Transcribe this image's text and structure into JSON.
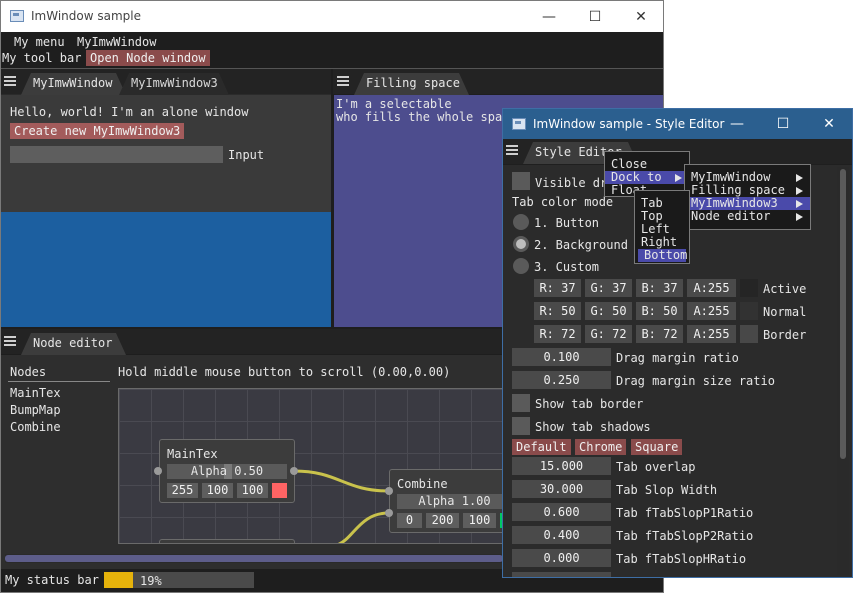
{
  "main_window": {
    "title": "ImWindow sample",
    "controls": {
      "minimize": "—",
      "maximize": "☐",
      "close": "✕"
    },
    "menu": [
      "My menu",
      "MyImwWindow"
    ],
    "toolbar": {
      "label": "My tool bar",
      "open_node_button": "Open Node window"
    },
    "left_panel": {
      "tabs": [
        "MyImwWindow",
        "MyImwWindow3"
      ],
      "hello_text": "Hello, world! I'm an alone window",
      "create_button": "Create new MyImwWindow3",
      "input_label": "Input",
      "input_value": ""
    },
    "right_panel": {
      "tab": "Filling space",
      "selectable_text": [
        "I'm a selectable",
        "who fills the whole space"
      ]
    },
    "node_editor": {
      "tab": "Node editor",
      "list_header": "Nodes",
      "nodes_list": [
        "MainTex",
        "BumpMap",
        "Combine"
      ],
      "hint": "Hold middle mouse button to scroll (0.00,0.00)",
      "node_maintex": {
        "title": "MainTex",
        "alpha_label": "Alpha 0.50",
        "rgb": [
          "255",
          "100",
          "100"
        ],
        "swatch": "#ff6464"
      },
      "node_combine": {
        "title": "Combine",
        "alpha_label": "Alpha 1.00",
        "rgb": [
          "0",
          "200",
          "100"
        ],
        "swatch": "#00c864"
      }
    },
    "status_bar": {
      "label": "My status bar",
      "progress_text": "19%",
      "progress": 0.19
    }
  },
  "style_editor": {
    "title": "ImWindow sample - Style Editor",
    "tab": "Style Editor",
    "visible_drag_label": "Visible dr",
    "tab_color_mode_label": "Tab color mode",
    "radio_options": [
      "1. Button",
      "2. Background",
      "3. Custom"
    ],
    "radio_selected": 1,
    "color_rows": [
      {
        "r": "R: 37",
        "g": "G: 37",
        "b": "B: 37",
        "a": "A:255",
        "label": "Active",
        "swatch": "#252525"
      },
      {
        "r": "R: 50",
        "g": "G: 50",
        "b": "B: 50",
        "a": "A:255",
        "label": "Normal",
        "swatch": "#323232"
      },
      {
        "r": "R: 72",
        "g": "G: 72",
        "b": "B: 72",
        "a": "A:255",
        "label": "Border",
        "swatch": "#484848"
      }
    ],
    "drag_margin": {
      "value": "0.100",
      "label": "Drag margin ratio"
    },
    "drag_margin_size": {
      "value": "0.250",
      "label": "Drag margin size ratio"
    },
    "show_tab_border": "Show tab border",
    "show_tab_shadows": "Show tab shadows",
    "presets": [
      "Default",
      "Chrome",
      "Square"
    ],
    "params": [
      {
        "value": "15.000",
        "label": "Tab overlap"
      },
      {
        "value": "30.000",
        "label": "Tab Slop Width"
      },
      {
        "value": "0.600",
        "label": "Tab fTabSlopP1Ratio"
      },
      {
        "value": "0.400",
        "label": "Tab fTabSlopP2Ratio"
      },
      {
        "value": "0.000",
        "label": "Tab fTabSlopHRatio"
      }
    ]
  },
  "context_menu": {
    "items": [
      "Close",
      "Dock to",
      "Float"
    ],
    "dock_submenu": [
      "MyImwWindow",
      "Filling space",
      "MyImwWindow3",
      "Node editor"
    ],
    "position_submenu": [
      "Tab",
      "Top",
      "Left",
      "Right",
      "Bottom"
    ],
    "highlighted_item": "Dock to",
    "highlighted_target": "MyImwWindow3",
    "highlighted_position": "Bottom"
  },
  "colors": {
    "accent_blue": "#1c5fa0",
    "selectable_purple": "#4d4d8e",
    "button_red": "#a35b5b",
    "progress_yellow": "#e5b20b",
    "link_yellow": "#c9c24c"
  }
}
